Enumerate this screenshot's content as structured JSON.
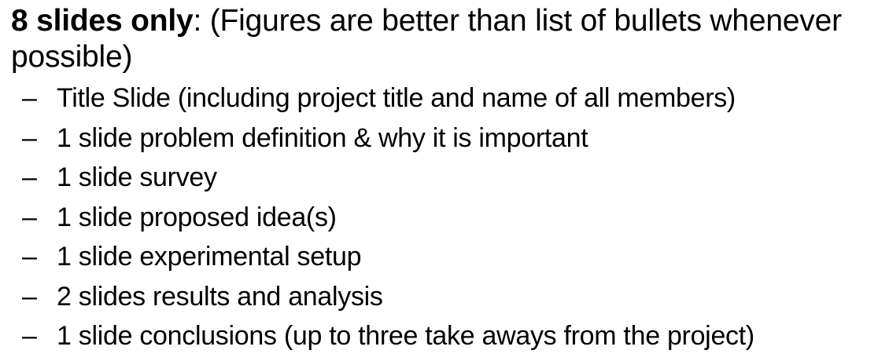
{
  "slide": {
    "heading_bold": "8 slides only",
    "heading_rest": ": (Figures are better than list of bullets whenever possible)",
    "bullet_marker": "–",
    "items": [
      "Title Slide (including project title and name of all members)",
      "1 slide problem definition & why it is important",
      "1 slide survey",
      "1 slide proposed idea(s)",
      "1 slide experimental setup",
      "2 slides results and analysis",
      "1 slide conclusions (up to three take aways from the project)"
    ]
  }
}
